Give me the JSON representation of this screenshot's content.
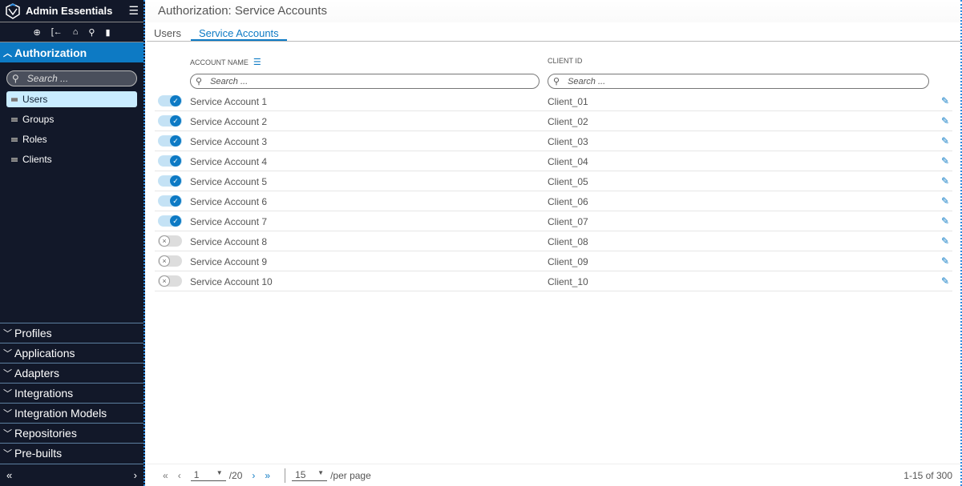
{
  "app": {
    "title": "Admin Essentials"
  },
  "sidebar": {
    "section_open": "Authorization",
    "search_placeholder": "Search ...",
    "items": [
      {
        "label": "Users",
        "active": true
      },
      {
        "label": "Groups"
      },
      {
        "label": "Roles"
      },
      {
        "label": "Clients"
      }
    ],
    "sections": [
      "Profiles",
      "Applications",
      "Adapters",
      "Integrations",
      "Integration Models",
      "Repositories",
      "Pre-builts"
    ],
    "collapse": "«",
    "expand": "›"
  },
  "header": {
    "title": "Authorization: Service Accounts"
  },
  "tabs": [
    {
      "label": "Users"
    },
    {
      "label": "Service Accounts",
      "active": true
    }
  ],
  "table": {
    "col_name": "ACCOUNT NAME",
    "col_client": "CLIENT ID",
    "search_placeholder": "Search ...",
    "rows": [
      {
        "name": "Service Account 1",
        "client": "Client_01",
        "enabled": true
      },
      {
        "name": "Service Account 2",
        "client": "Client_02",
        "enabled": true
      },
      {
        "name": "Service Account 3",
        "client": "Client_03",
        "enabled": true
      },
      {
        "name": "Service Account 4",
        "client": "Client_04",
        "enabled": true
      },
      {
        "name": "Service Account 5",
        "client": "Client_05",
        "enabled": true
      },
      {
        "name": "Service Account 6",
        "client": "Client_06",
        "enabled": true
      },
      {
        "name": "Service Account 7",
        "client": "Client_07",
        "enabled": true
      },
      {
        "name": "Service Account 8",
        "client": "Client_08",
        "enabled": false
      },
      {
        "name": "Service Account 9",
        "client": "Client_09",
        "enabled": false
      },
      {
        "name": "Service Account 10",
        "client": "Client_10",
        "enabled": false
      }
    ]
  },
  "pager": {
    "page": "1",
    "total_pages": "/20",
    "per_page": "15",
    "per_page_label": "/per page",
    "range": "1-15 of 300"
  },
  "colors": {
    "accent": "#0d7ac4",
    "sidebar": "#121829"
  }
}
